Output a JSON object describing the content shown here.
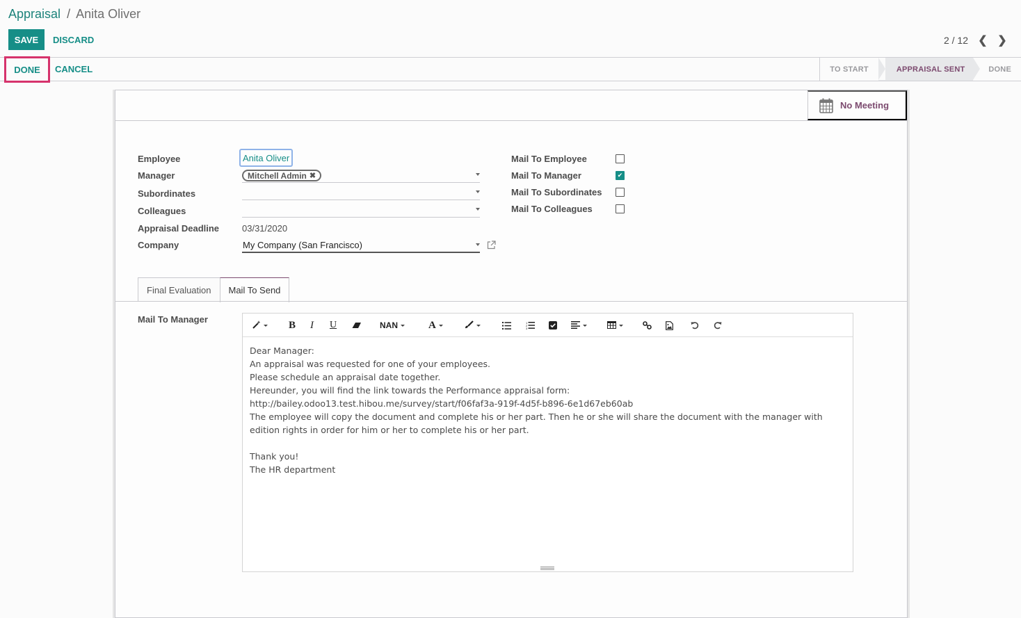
{
  "breadcrumb": {
    "parent": "Appraisal",
    "separator": "/",
    "current": "Anita Oliver"
  },
  "control_panel": {
    "save_label": "SAVE",
    "discard_label": "DISCARD"
  },
  "pager": {
    "value": "2 / 12",
    "prev_icon": "chevron-left-icon",
    "next_icon": "chevron-right-icon"
  },
  "statusbar": {
    "done_label": "DONE",
    "cancel_label": "CANCEL",
    "stages": [
      {
        "label": "TO START",
        "active": false
      },
      {
        "label": "APPRAISAL SENT",
        "active": true
      },
      {
        "label": "DONE",
        "active": false
      }
    ]
  },
  "button_box": {
    "meeting_label": "No Meeting",
    "meeting_icon": "calendar-icon"
  },
  "form": {
    "left": {
      "employee": {
        "label": "Employee",
        "value": "Anita Oliver"
      },
      "manager": {
        "label": "Manager",
        "tags": [
          "Mitchell Admin"
        ]
      },
      "subordinates": {
        "label": "Subordinates",
        "value": ""
      },
      "colleagues": {
        "label": "Colleagues",
        "value": ""
      },
      "deadline": {
        "label": "Appraisal Deadline",
        "value": "03/31/2020"
      },
      "company": {
        "label": "Company",
        "value": "My Company (San Francisco)"
      }
    },
    "right": [
      {
        "label": "Mail To Employee",
        "checked": false
      },
      {
        "label": "Mail To Manager",
        "checked": true
      },
      {
        "label": "Mail To Subordinates",
        "checked": false
      },
      {
        "label": "Mail To Colleagues",
        "checked": false
      }
    ]
  },
  "tabs": [
    {
      "label": "Final Evaluation",
      "active": false
    },
    {
      "label": "Mail To Send",
      "active": true
    }
  ],
  "mail_to_manager": {
    "label": "Mail To Manager",
    "toolbar": {
      "font_size_label": "NAN",
      "font_color_label": "A",
      "bold": "B",
      "italic": "I",
      "underline": "U"
    },
    "body": [
      "Dear Manager:",
      "An appraisal was requested for one of your employees.",
      "Please schedule an appraisal date together.",
      "Hereunder, you will find the link towards the Performance appraisal form:",
      "http://bailey.odoo13.test.hibou.me/survey/start/f06faf3a-919f-4d5f-b896-6e1d67eb60ab",
      "The employee will copy the document and complete his or her part. Then he or she will share the document with the manager with edition rights in order for him or her to complete his or her part.",
      "",
      "Thank you!",
      "The HR department"
    ]
  },
  "colors": {
    "primary": "#168e87",
    "accent": "#7c4a6f",
    "highlight": "#d6336c"
  }
}
